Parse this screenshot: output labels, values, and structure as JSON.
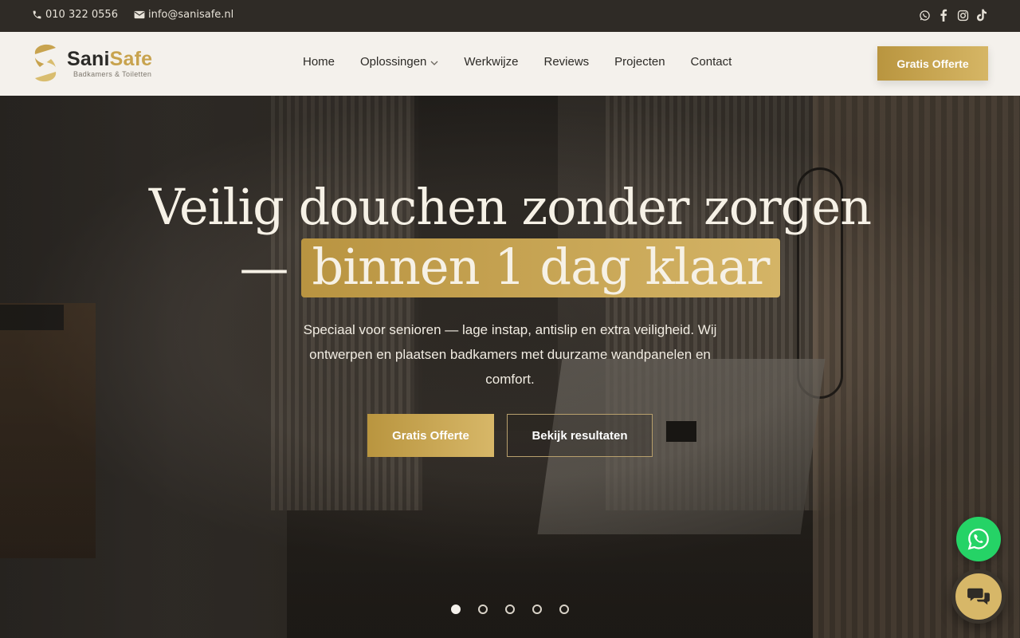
{
  "topbar": {
    "phone": "010 322 0556",
    "email": "info@sanisafe.nl",
    "social": [
      "whatsapp-icon",
      "facebook-icon",
      "instagram-icon",
      "tiktok-icon"
    ]
  },
  "header": {
    "logo": {
      "part1": "Sani",
      "part2": "Safe",
      "tagline": "Badkamers & Toiletten"
    },
    "nav": [
      {
        "label": "Home"
      },
      {
        "label": "Oplossingen",
        "has_dropdown": true
      },
      {
        "label": "Werkwijze"
      },
      {
        "label": "Reviews"
      },
      {
        "label": "Projecten"
      },
      {
        "label": "Contact"
      }
    ],
    "cta": "Gratis Offerte"
  },
  "hero": {
    "title_line1": "Veilig douchen zonder zorgen",
    "title_dash": "—",
    "title_highlight": "binnen 1 dag klaar",
    "subtitle": "Speciaal voor senioren — lage instap, antislip en extra veiligheid. Wij ontwerpen en plaatsen badkamers met duurzame wandpanelen en comfort.",
    "primary_button": "Gratis Offerte",
    "secondary_button": "Bekijk resultaten",
    "slides_total": 5,
    "active_slide": 1
  },
  "floating": {
    "whatsapp": "whatsapp-icon",
    "chat": "chat-bubbles-icon"
  },
  "colors": {
    "gold": "#c8a34e",
    "topbar": "#2f2b26",
    "header_bg": "#f4f1ec",
    "whatsapp": "#25d366"
  }
}
